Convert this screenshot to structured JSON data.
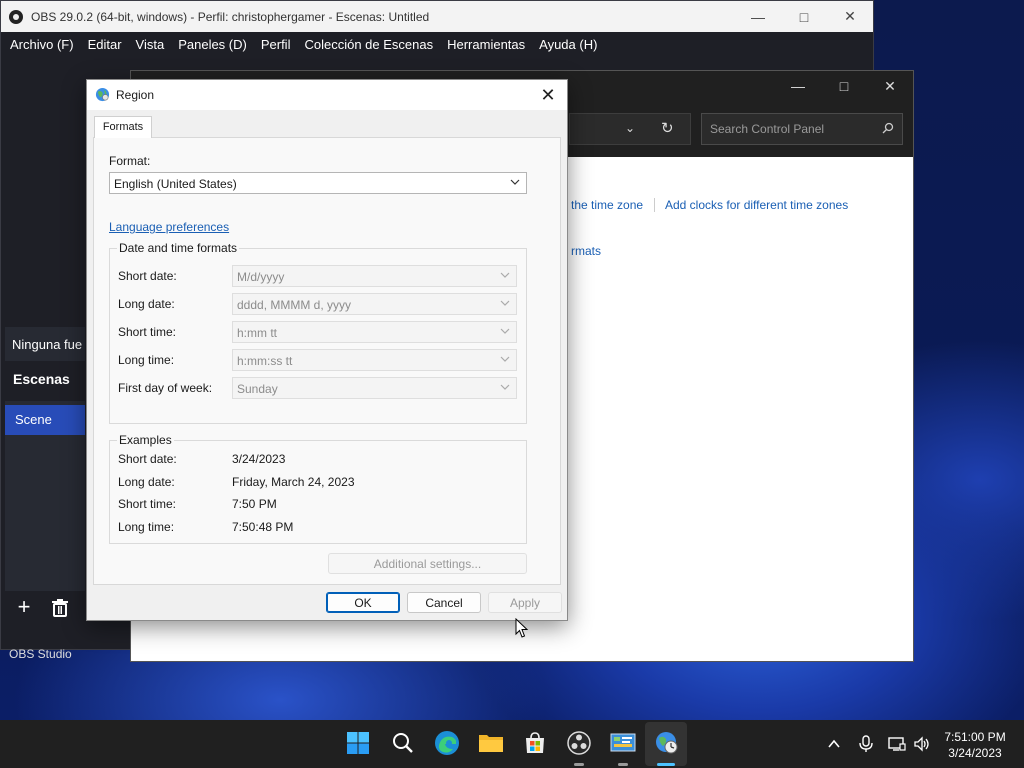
{
  "obs": {
    "title": "OBS 29.0.2 (64-bit, windows) - Perfil: christophergamer - Escenas: Untitled",
    "menu": [
      "Archivo (F)",
      "Editar",
      "Vista",
      "Paneles (D)",
      "Perfil",
      "Colección de Escenas",
      "Herramientas",
      "Ayuda (H)"
    ],
    "no_source": "Ninguna fue",
    "scenes_title": "Escenas",
    "scene_item": "Scene",
    "status_text": "OBS Studio"
  },
  "control_panel": {
    "search_placeholder": "Search Control Panel",
    "link_time_zone": "the time zone",
    "link_add_clocks": "Add clocks for different time zones",
    "link_formats": "rmats"
  },
  "region": {
    "title": "Region",
    "tab": "Formats",
    "format_label": "Format:",
    "format_value": "English (United States)",
    "language_link": "Language preferences",
    "datetime_group": "Date and time formats",
    "datetime_rows": [
      {
        "label": "Short date:",
        "value": "M/d/yyyy"
      },
      {
        "label": "Long date:",
        "value": "dddd, MMMM d, yyyy"
      },
      {
        "label": "Short time:",
        "value": "h:mm tt"
      },
      {
        "label": "Long time:",
        "value": "h:mm:ss tt"
      },
      {
        "label": "First day of week:",
        "value": "Sunday"
      }
    ],
    "examples_group": "Examples",
    "examples": [
      {
        "label": "Short date:",
        "value": "3/24/2023"
      },
      {
        "label": "Long date:",
        "value": "Friday, March 24, 2023"
      },
      {
        "label": "Short time:",
        "value": "7:50 PM"
      },
      {
        "label": "Long time:",
        "value": "7:50:48 PM"
      }
    ],
    "additional_settings": "Additional settings...",
    "ok": "OK",
    "cancel": "Cancel",
    "apply": "Apply"
  },
  "taskbar": {
    "time": "7:51:00 PM",
    "date": "3/24/2023"
  },
  "colors": {
    "accent": "#005fb8",
    "link": "#1a5fb4",
    "obs_scene_selected": "#284cb8"
  }
}
